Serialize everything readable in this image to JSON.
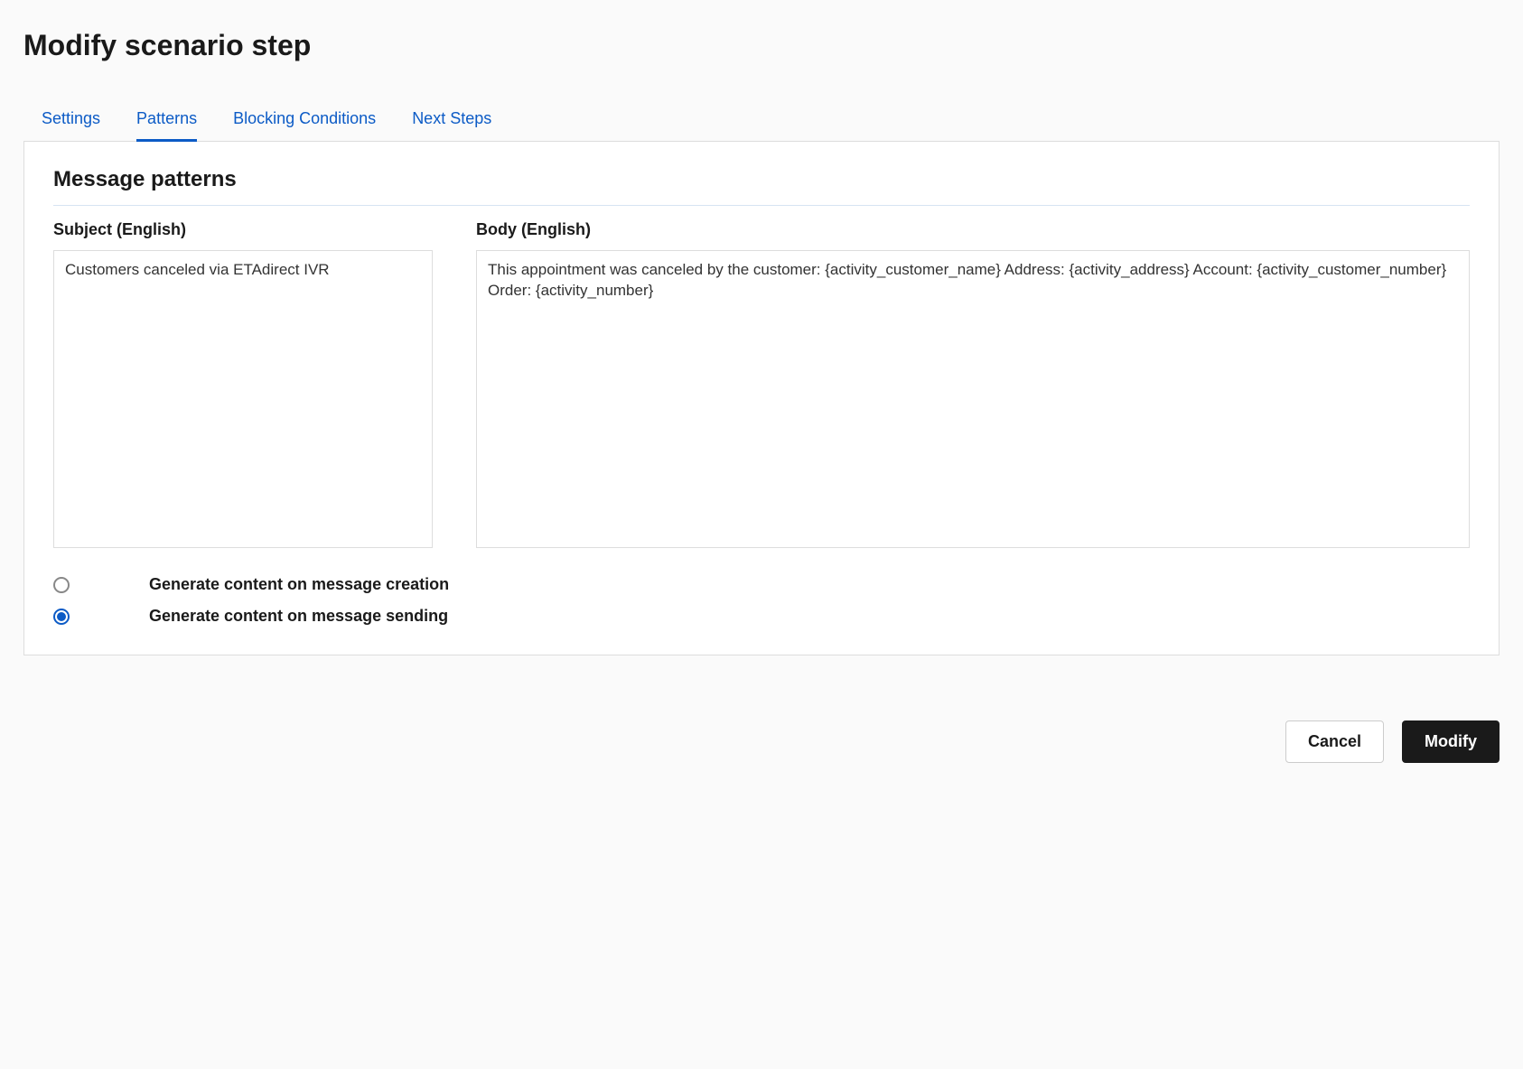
{
  "page": {
    "title": "Modify scenario step"
  },
  "tabs": {
    "items": [
      {
        "label": "Settings",
        "active": false
      },
      {
        "label": "Patterns",
        "active": true
      },
      {
        "label": "Blocking Conditions",
        "active": false
      },
      {
        "label": "Next Steps",
        "active": false
      }
    ]
  },
  "section": {
    "title": "Message patterns"
  },
  "fields": {
    "subject": {
      "label": "Subject (English)",
      "value": "Customers canceled via ETAdirect IVR"
    },
    "body": {
      "label": "Body (English)",
      "value": "This appointment was canceled by the customer: {activity_customer_name} Address: {activity_address} Account: {activity_customer_number} Order: {activity_number}"
    }
  },
  "radios": {
    "options": [
      {
        "label": "Generate content on message creation",
        "checked": false
      },
      {
        "label": "Generate content on message sending",
        "checked": true
      }
    ]
  },
  "buttons": {
    "cancel": "Cancel",
    "modify": "Modify"
  }
}
